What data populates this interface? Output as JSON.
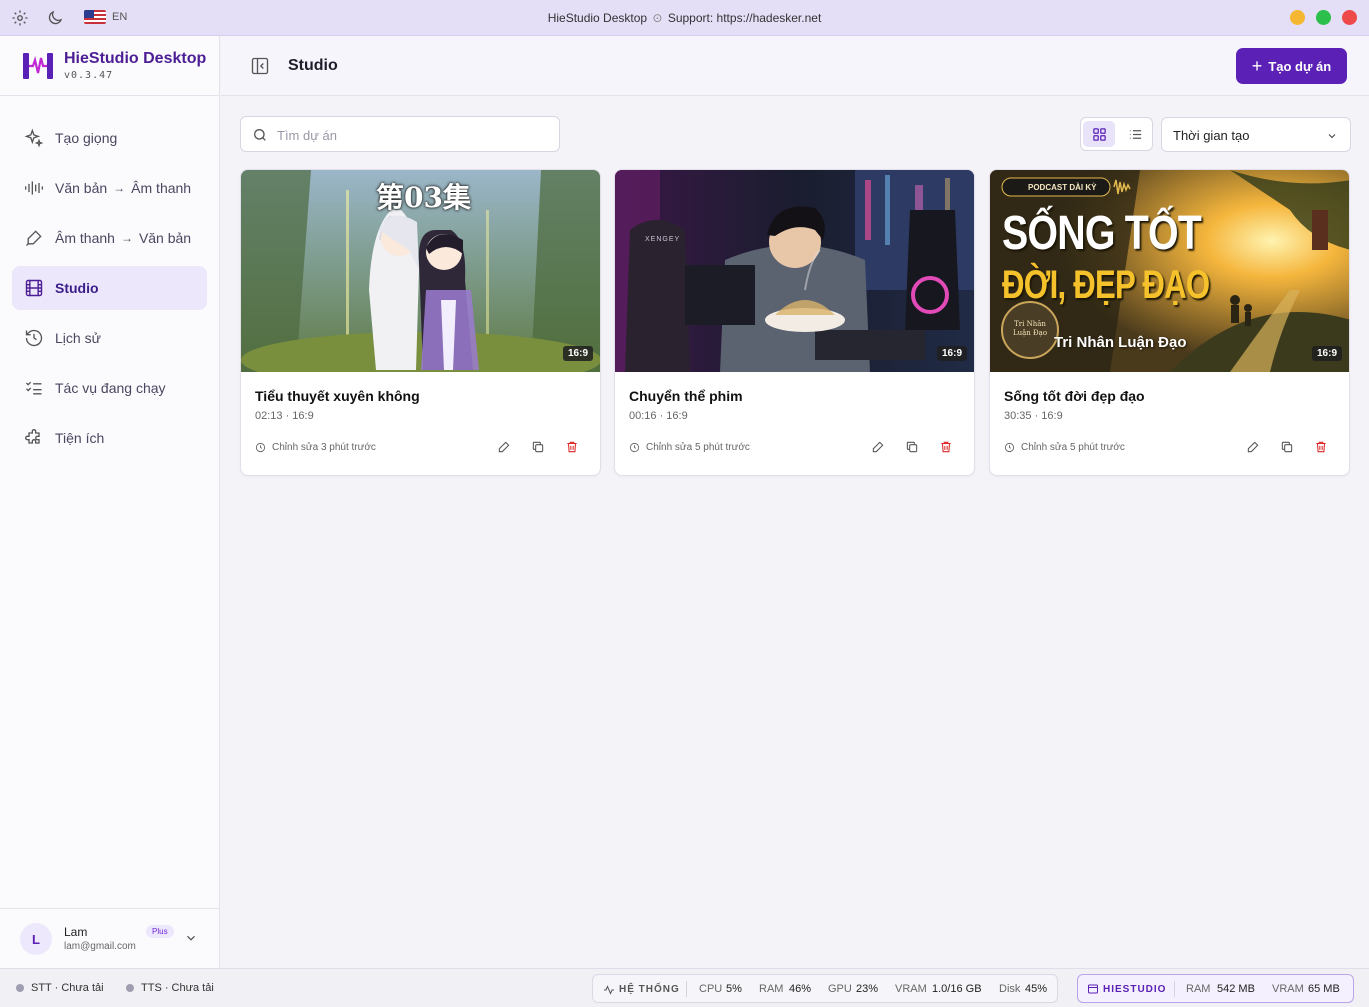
{
  "titlebar": {
    "language": "EN",
    "app_title": "HieStudio Desktop",
    "separator": "⊙",
    "support_label": "Support:",
    "support_url": "https://hadesker.net",
    "icons": [
      "settings-icon",
      "dark-mode-icon",
      "us-flag-icon"
    ],
    "window_buttons": {
      "minimize": "#f5b731",
      "maximize": "#2dbf4c",
      "close": "#ee4a4a"
    }
  },
  "brand": {
    "name": "HieStudio Desktop",
    "version": "v0.3.47",
    "color": "#5b21b6"
  },
  "sidebar": {
    "items": [
      {
        "label": "Tạo giọng",
        "icon": "sparkles-icon",
        "active": false
      },
      {
        "label_from": "Văn bản",
        "label_to": "Âm thanh",
        "icon": "audio-wave-icon",
        "active": false
      },
      {
        "label_from": "Âm thanh",
        "label_to": "Văn bản",
        "icon": "pen-mic-icon",
        "active": false
      },
      {
        "label": "Studio",
        "icon": "film-icon",
        "active": true
      },
      {
        "label": "Lịch sử",
        "icon": "history-icon",
        "active": false
      },
      {
        "label": "Tác vụ đang chạy",
        "icon": "task-list-icon",
        "active": false
      },
      {
        "label": "Tiện ích",
        "icon": "puzzle-icon",
        "active": false
      }
    ],
    "arrow": "→"
  },
  "user": {
    "initial": "L",
    "name": "Lam",
    "email": "lam@gmail.com",
    "plan": "Plus"
  },
  "header": {
    "title": "Studio",
    "create_label": "Tạo dự án",
    "create_icon": "+"
  },
  "toolbar": {
    "search_placeholder": "Tìm dự án",
    "search_value": "",
    "view_mode": "grid",
    "sort_selected": "Thời gian tạo"
  },
  "projects": [
    {
      "title": "Tiểu thuyết xuyên không",
      "meta": "02:13 · 16:9",
      "aspect": "16:9",
      "edited": "Chỉnh sửa 3 phút trước",
      "thumb_text": "第03集"
    },
    {
      "title": "Chuyển thể phim",
      "meta": "00:16 · 16:9",
      "aspect": "16:9",
      "edited": "Chỉnh sửa 5 phút trước",
      "thumb_text": "XENGEY"
    },
    {
      "title": "Sống tốt đời đẹp đạo",
      "meta": "30:35 · 16:9",
      "aspect": "16:9",
      "edited": "Chỉnh sửa 5 phút trước",
      "thumb_badge": "PODCAST DÀI KỲ",
      "thumb_line1": "SỐNG TỐT",
      "thumb_line2": "ĐỜI, ĐẸP ĐẠO",
      "thumb_author": "Tri Nhân Luận Đạo",
      "thumb_seal": "Tri Nhân Luận Đạo"
    }
  ],
  "statusbar": {
    "stt": "STT · Chưa tải",
    "tts": "TTS · Chưa tải",
    "system_label": "HỆ THỐNG",
    "cpu_label": "CPU",
    "cpu_value": "5%",
    "ram_label": "RAM",
    "ram_value": "46%",
    "gpu_label": "GPU",
    "gpu_value": "23%",
    "vram_label": "VRAM",
    "vram_value": "1.0/16 GB",
    "disk_label": "Disk",
    "disk_value": "45%",
    "app_label": "HIESTUDIO",
    "app_ram_label": "RAM",
    "app_ram_value": "542 MB",
    "app_vram_label": "VRAM",
    "app_vram_value": "65 MB"
  }
}
